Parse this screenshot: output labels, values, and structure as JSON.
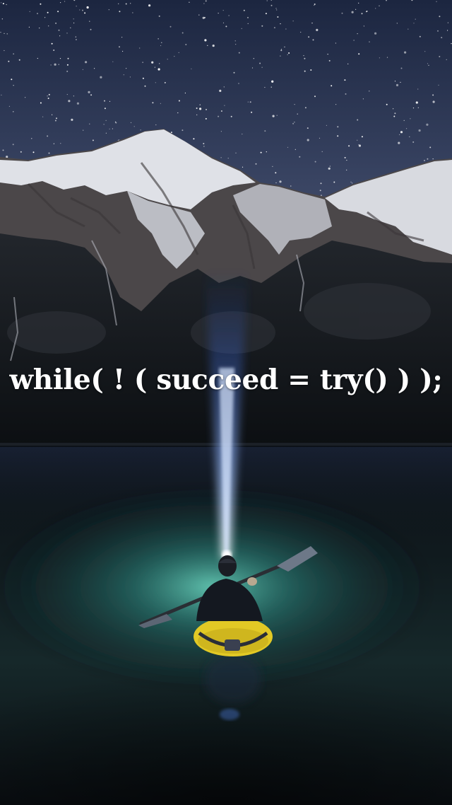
{
  "caption": {
    "text": "while( ! ( succeed = try() ) );"
  },
  "colors": {
    "sky_top": "#1f2a44",
    "sky_bottom": "#3a4564",
    "snow": "#e4e6ec",
    "rock": "#4a4548",
    "forest": "#14181c",
    "water_glow": "#3fa08e",
    "beam": "#7fb4ff",
    "kayak": "#e8cf2a",
    "caption_text": "#ffffff"
  },
  "scene": {
    "elements": [
      "starry-sky",
      "snowy-mountains",
      "dark-forest",
      "lake",
      "light-beam",
      "kayaker"
    ]
  }
}
